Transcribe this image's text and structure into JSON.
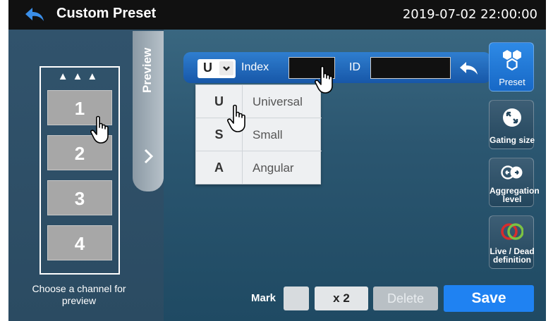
{
  "header": {
    "title": "Custom Preset",
    "datetime": "2019-07-02  22:00:00"
  },
  "left_panel": {
    "up_arrows": "▲▲▲",
    "channels": [
      "1",
      "2",
      "3",
      "4"
    ],
    "choose_text": "Choose a channel for preview"
  },
  "preview_tab": {
    "label": "Preview"
  },
  "index_bar": {
    "type_value": "U",
    "index_label": "Index",
    "index_value": "",
    "id_label": "ID",
    "id_value": ""
  },
  "dropdown": {
    "options": [
      {
        "letter": "U",
        "name": "Universal"
      },
      {
        "letter": "S",
        "name": "Small"
      },
      {
        "letter": "A",
        "name": "Angular"
      }
    ]
  },
  "side_buttons": {
    "preset": "Preset",
    "gating_size": "Gating size",
    "aggregation_line1": "Aggregation",
    "aggregation_line2": "level",
    "livedead_line1": "Live / Dead",
    "livedead_line2": "definition"
  },
  "bottom_bar": {
    "mark_label": "Mark",
    "x2_label": "x 2",
    "delete_label": "Delete",
    "save_label": "Save"
  },
  "colors": {
    "accent_blue": "#1f82f2",
    "header_bg": "#111111",
    "live_ring": "#d92c2c",
    "dead_ring": "#7cc242"
  },
  "icons": [
    "back-arrow-icon",
    "chevron-down-icon",
    "chevron-right-icon",
    "return-arrow-icon",
    "hexagons-icon",
    "gating-size-icon",
    "aggregation-icon",
    "live-dead-rings-icon",
    "hand-cursor-icon"
  ]
}
